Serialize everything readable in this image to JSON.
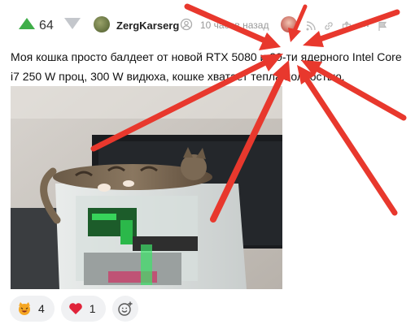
{
  "post": {
    "rating": "64",
    "author": "ZergKarserg",
    "time": "10 часов назад",
    "text": "Моя кошка просто балдеет от новой RTX 5080 и 20-ти ядерного Intel Core i7 250 W проц, 300 W видюха, кошке хватает тепла полностью."
  },
  "reactions": [
    {
      "emoji": "laughing-cat",
      "count": "4"
    },
    {
      "emoji": "heart",
      "count": "1"
    }
  ],
  "colors": {
    "upvote": "#3fae49",
    "arrow": "#e8382d",
    "reaction_bg": "#f0f1f3"
  }
}
